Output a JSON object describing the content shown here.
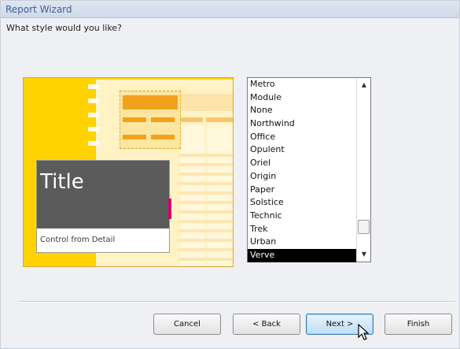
{
  "window": {
    "title": "Report Wizard"
  },
  "prompt": "What style would you like?",
  "preview": {
    "title_text": "Title",
    "control_text": "Control from Detail"
  },
  "style_list": {
    "items": [
      "Metro",
      "Module",
      "None",
      "Northwind",
      "Office",
      "Opulent",
      "Oriel",
      "Origin",
      "Paper",
      "Solstice",
      "Technic",
      "Trek",
      "Urban",
      "Verve"
    ],
    "selected": "Verve"
  },
  "buttons": {
    "cancel": "Cancel",
    "back": "< Back",
    "next": "Next >",
    "finish": "Finish"
  },
  "colors": {
    "accent_orange": "#f3a11b",
    "preview_yellow": "#ffd200",
    "selection": "#000000"
  },
  "icons": {
    "cursor": "mouse-pointer-icon",
    "scroll_up": "scroll-up-arrow-icon",
    "scroll_down": "scroll-down-arrow-icon"
  }
}
